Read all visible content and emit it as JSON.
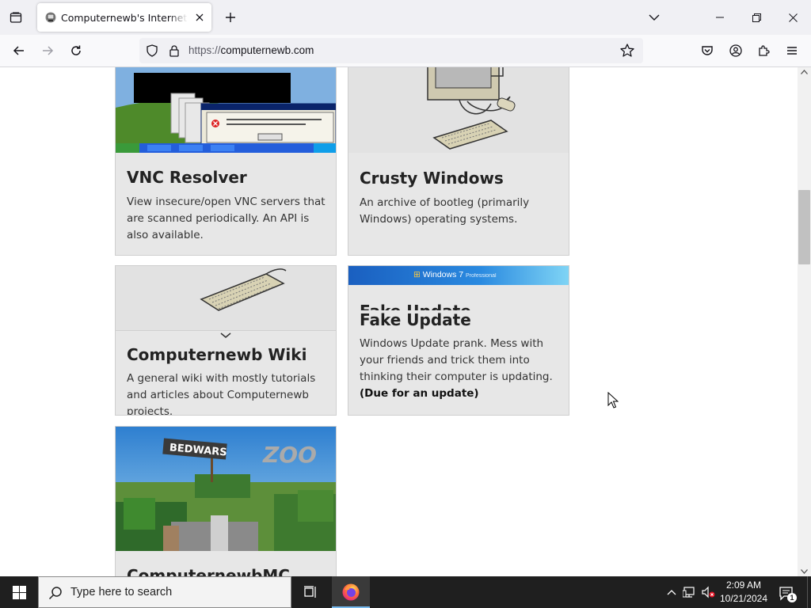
{
  "tab": {
    "title": "Computernewb's Internet Pub"
  },
  "urlbar": {
    "protocol": "https://",
    "domain": "computernewb.com"
  },
  "cards": [
    {
      "id": "vnc",
      "title": "VNC Resolver",
      "description": "View insecure/open VNC servers that are scanned periodically. An API is also available."
    },
    {
      "id": "crusty",
      "title": "Crusty Windows",
      "description": "An archive of bootleg (primarily Windows) operating systems."
    },
    {
      "id": "wiki",
      "title": "Computernewb Wiki",
      "description": "A general wiki with mostly tutorials and articles about Computernewb projects."
    },
    {
      "id": "fake",
      "title": "Fake Update",
      "description": "Windows Update prank. Mess with your friends and trick them into thinking their computer is updating.",
      "note": "(Due for an update)",
      "thumb_text": "Windows 7",
      "thumb_subtext": "Professional",
      "alt_overlay": "Fake Update"
    },
    {
      "id": "mc",
      "title": "ComputernewbMC",
      "thumb_signs": [
        "BEDWARS",
        "ZOO"
      ]
    }
  ],
  "taskbar": {
    "search_placeholder": "Type here to search",
    "time": "2:09 AM",
    "date": "10/21/2024",
    "notification_count": "1"
  },
  "colors": {
    "card_bg": "#e7e7e7",
    "taskbar": "#1f1f1f",
    "accent": "#0078d4"
  }
}
